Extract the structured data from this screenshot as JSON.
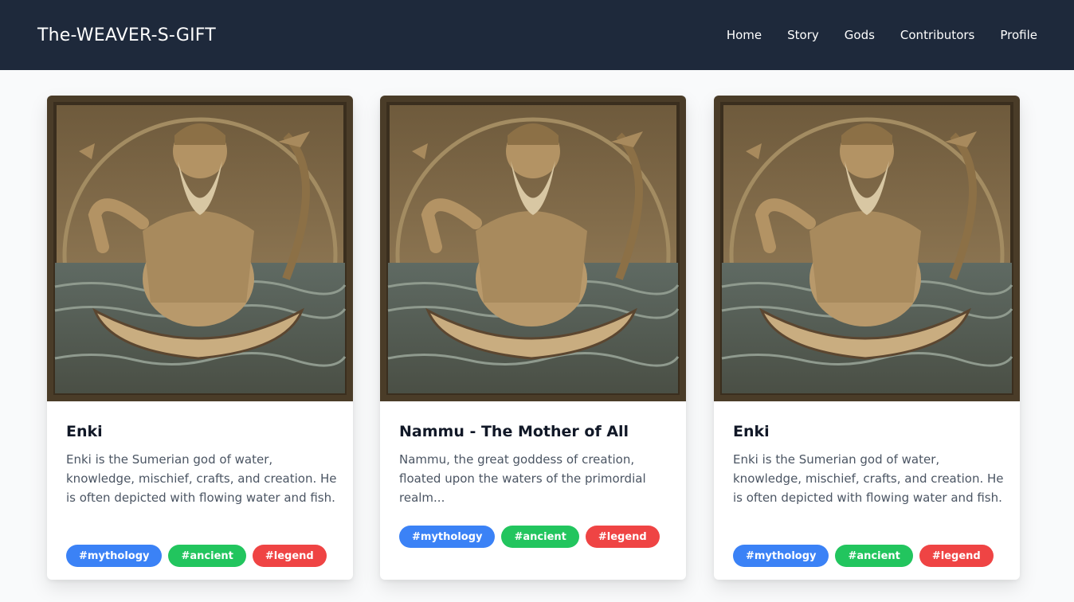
{
  "nav": {
    "brand": "The-WEAVER-S-GIFT",
    "links": [
      "Home",
      "Story",
      "Gods",
      "Contributors",
      "Profile"
    ]
  },
  "cards": [
    {
      "title": "Enki",
      "description": "Enki is the Sumerian god of water, knowledge, mischief, crafts, and creation. He is often depicted with flowing water and fish.",
      "tags": [
        "#mythology",
        "#ancient",
        "#legend"
      ]
    },
    {
      "title": "Nammu - The Mother of All",
      "description": "Nammu, the great goddess of creation, floated upon the waters of the primordial realm...",
      "tags": [
        "#mythology",
        "#ancient",
        "#legend"
      ]
    },
    {
      "title": "Enki",
      "description": "Enki is the Sumerian god of water, knowledge, mischief, crafts, and creation. He is often depicted with flowing water and fish.",
      "tags": [
        "#mythology",
        "#ancient",
        "#legend"
      ]
    }
  ],
  "colors": {
    "navbar": "#1e293b",
    "tag_mythology": "#3b82f6",
    "tag_ancient": "#22c55e",
    "tag_legend": "#ef4444"
  },
  "icons": {
    "card_image": "relief-carving-deity-in-boat"
  }
}
